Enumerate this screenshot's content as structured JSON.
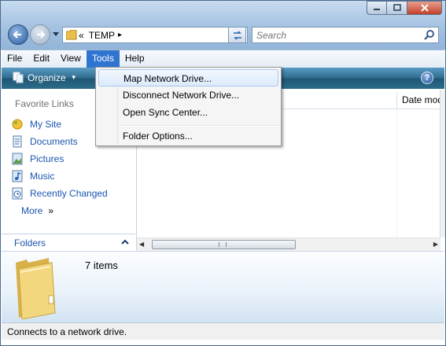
{
  "window": {
    "controls": {
      "minimize_icon": "minimize-icon",
      "maximize_icon": "maximize-icon",
      "close_icon": "close-icon"
    }
  },
  "address": {
    "overflow": "«",
    "folder": "TEMP",
    "separator": "▸"
  },
  "search": {
    "placeholder": "Search"
  },
  "menubar": {
    "items": [
      "File",
      "Edit",
      "View",
      "Tools",
      "Help"
    ],
    "active": "Tools"
  },
  "toolbar": {
    "organize_label": "Organize",
    "organize_arrow": "▼",
    "help_label": "?"
  },
  "favorites": {
    "header": "Favorite Links",
    "links": [
      "My Site",
      "Documents",
      "Pictures",
      "Music",
      "Recently Changed"
    ],
    "more_label": "More",
    "more_chevron": "»"
  },
  "folders": {
    "label": "Folders",
    "toggle": "⌃"
  },
  "filelist": {
    "columns": [
      "Date mod"
    ]
  },
  "details": {
    "item_count": "7 items"
  },
  "status": {
    "text": "Connects to a network drive."
  },
  "tools_menu": {
    "items": [
      "Map Network Drive...",
      "Disconnect Network Drive...",
      "Open Sync Center...",
      "Folder Options..."
    ],
    "highlighted": "Map Network Drive..."
  },
  "colors": {
    "accent": "#2f74d0",
    "link": "#1a56b0",
    "cmdbar": "#2b6d8a"
  }
}
